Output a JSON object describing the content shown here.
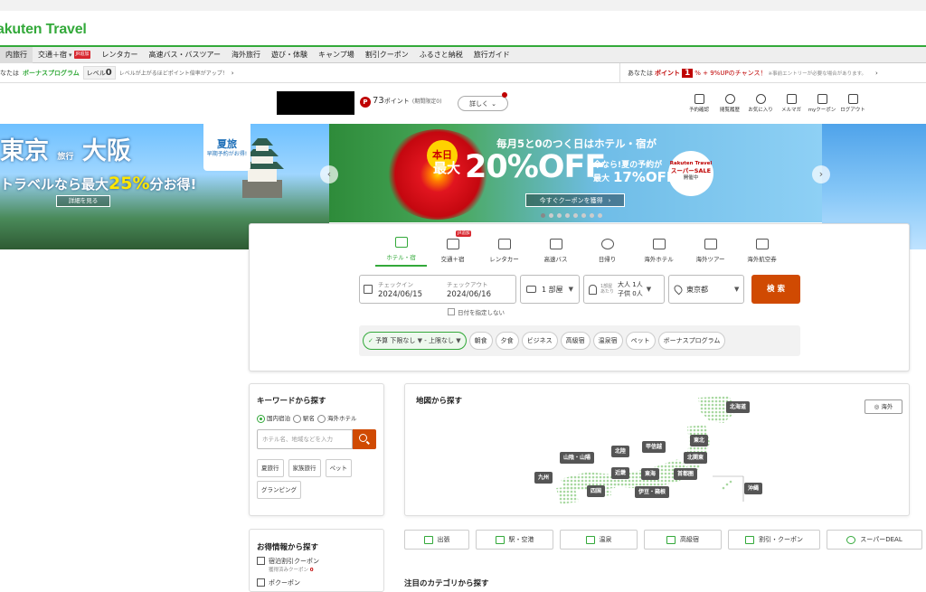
{
  "header": {
    "logo_main": "akuten",
    "logo_travel": " Travel"
  },
  "nav": {
    "items": [
      {
        "label": "内旅行",
        "active": true
      },
      {
        "label": "交通＋宿",
        "badge": "JR追加"
      },
      {
        "label": "レンタカー"
      },
      {
        "label": "高速バス・バスツアー"
      },
      {
        "label": "海外旅行"
      },
      {
        "label": "遊び・体験"
      },
      {
        "label": "キャンプ場"
      },
      {
        "label": "割引クーポン"
      },
      {
        "label": "ふるさと納税"
      },
      {
        "label": "旅行ガイド"
      }
    ]
  },
  "bonus": {
    "left_a": "なたは",
    "left_program": "ボーナスプログラム",
    "level_label": "レベル",
    "level_value": "0",
    "level_hint": "レベルが上がるほどポイント倍率がアップ！",
    "right_a": "あなたは",
    "right_point": "ポイント",
    "right_mult": "1",
    "right_pct": "% + 9%UPのチャンス！",
    "right_note": "※事前エントリーが必要な場合があります。"
  },
  "account": {
    "points_value": "73",
    "points_unit": "ポイント",
    "points_note": "(期間限定0)",
    "detail_label": "詳しく"
  },
  "utility": [
    {
      "label": "予約確認",
      "icon": "calendar-icon"
    },
    {
      "label": "閲覧履歴",
      "icon": "history-icon"
    },
    {
      "label": "お気に入り",
      "icon": "heart-icon"
    },
    {
      "label": "メルマガ",
      "icon": "mail-icon"
    },
    {
      "label": "myクーポン",
      "icon": "coupon-icon"
    },
    {
      "label": "ログアウト",
      "icon": "logout-icon"
    }
  ],
  "banners": {
    "left": {
      "city1": "東京",
      "city_small": "旅行",
      "city2": "大阪",
      "promo_a": "トラベルなら最大",
      "promo_pct": "25%",
      "promo_b": "分お得!",
      "detail": "詳細を見る",
      "summer_title": "夏旅",
      "summer_sub": "早期予約がお得!"
    },
    "center": {
      "today": "本日",
      "title": "毎月5と0のつく日はホテル・宿が",
      "max": "最大",
      "pct": "20%OFF",
      "now_a": "今なら!夏の予約が",
      "now_b": "最大",
      "now_pct": "17%OFF",
      "sale_a": "Rakuten Travel",
      "sale_b": "スーパーSALE",
      "sale_c": "開催中",
      "coupon": "今すぐクーポンを獲得"
    }
  },
  "search": {
    "tabs": [
      {
        "label": "ホテル・宿",
        "icon": "hotel-icon",
        "active": true
      },
      {
        "label": "交通＋宿",
        "icon": "train-hotel-icon",
        "badge": "JR追加"
      },
      {
        "label": "レンタカー",
        "icon": "car-icon"
      },
      {
        "label": "高速バス",
        "icon": "bus-icon"
      },
      {
        "label": "日帰り",
        "icon": "sun-icon"
      },
      {
        "label": "海外ホテル",
        "icon": "globe-hotel-icon"
      },
      {
        "label": "海外ツアー",
        "icon": "tour-icon"
      },
      {
        "label": "海外航空券",
        "icon": "plane-icon"
      }
    ],
    "checkin_label": "チェックイン",
    "checkin_value": "2024/06/15",
    "checkout_label": "チェックアウト",
    "checkout_value": "2024/06/16",
    "rooms": "1 部屋",
    "guests_label_a": "1部屋",
    "guests_label_b": "あたり",
    "adults": "大人 1人",
    "children": "子供 0人",
    "area": "東京都",
    "search_btn": "検 索",
    "undecided": "日付を指定しない",
    "budget_a": "予算",
    "budget_b": "下限なし",
    "budget_c": "- 上限なし",
    "chips": [
      "朝食",
      "夕食",
      "ビジネス",
      "高級宿",
      "温泉宿",
      "ペット",
      "ボーナスプログラム"
    ]
  },
  "keyword": {
    "title": "キーワードから探す",
    "radios": [
      "国内宿泊",
      "駅名",
      "海外ホテル"
    ],
    "placeholder": "ホテル名、地域などを入力",
    "tags": [
      "夏旅行",
      "家族旅行",
      "ペット",
      "グランピング"
    ]
  },
  "map": {
    "title": "地図から探す",
    "overseas": "海外",
    "regions": [
      "北海道",
      "東北",
      "北関東",
      "甲信越",
      "首都圏",
      "北陸",
      "東海",
      "伊豆・箱根",
      "近畿",
      "山陰・山陽",
      "九州",
      "四国",
      "沖縄"
    ]
  },
  "quick": [
    {
      "label": "出張",
      "icon": "briefcase-icon"
    },
    {
      "label": "駅・空港",
      "icon": "station-icon"
    },
    {
      "label": "温泉",
      "icon": "onsen-icon"
    },
    {
      "label": "高級宿",
      "icon": "luxury-icon"
    },
    {
      "label": "割引・クーポン",
      "icon": "discount-icon"
    },
    {
      "label": "スーパーDEAL",
      "icon": "point-icon"
    }
  ],
  "deals": {
    "title": "お得情報から探す",
    "item1": "宿泊割引クーポン",
    "item1_sub": "獲得済みクーポン",
    "item1_count": "0",
    "item2": "ポクーポン"
  },
  "category": {
    "title": "注目のカテゴリから探す"
  }
}
